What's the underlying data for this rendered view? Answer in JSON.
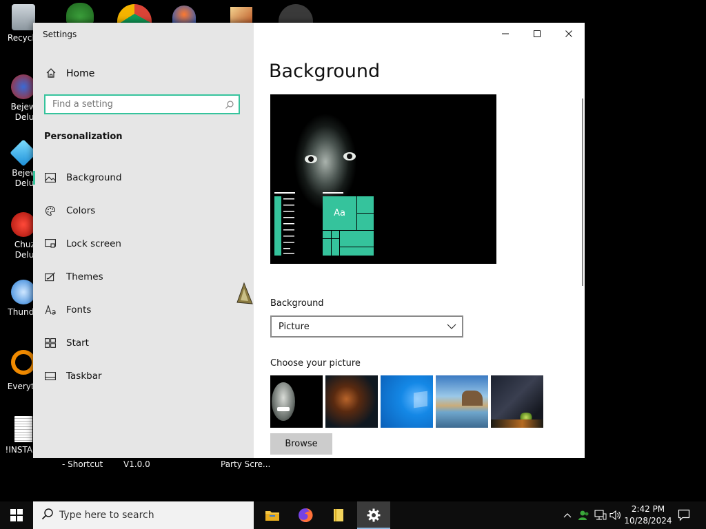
{
  "desktop": {
    "icons": [
      {
        "label": "Recycle"
      },
      {
        "label": "Bejewel Delux"
      },
      {
        "label": "Bejewe Delux"
      },
      {
        "label": "Chuzz Delux"
      },
      {
        "label": "Thunde"
      },
      {
        "label": "Everyth"
      },
      {
        "label": "!INSTALL"
      }
    ],
    "bottom_labels": [
      "- Shortcut",
      "V1.0.0",
      "Party Scre..."
    ]
  },
  "window": {
    "title": "Settings",
    "controls": {
      "minimize": "minimize",
      "maximize": "maximize",
      "close": "close"
    }
  },
  "sidebar": {
    "home_label": "Home",
    "search_placeholder": "Find a setting",
    "section_title": "Personalization",
    "items": [
      {
        "label": "Background",
        "icon": "picture-icon",
        "active": true
      },
      {
        "label": "Colors",
        "icon": "palette-icon",
        "active": false
      },
      {
        "label": "Lock screen",
        "icon": "lock-screen-icon",
        "active": false
      },
      {
        "label": "Themes",
        "icon": "themes-icon",
        "active": false
      },
      {
        "label": "Fonts",
        "icon": "fonts-icon",
        "active": false
      },
      {
        "label": "Start",
        "icon": "start-icon",
        "active": false
      },
      {
        "label": "Taskbar",
        "icon": "taskbar-icon",
        "active": false
      }
    ]
  },
  "main": {
    "title": "Background",
    "preview_tile_text": "Aa",
    "background_label": "Background",
    "background_value": "Picture",
    "choose_label": "Choose your picture",
    "browse_label": "Browse"
  },
  "taskbar": {
    "search_placeholder": "Type here to search",
    "time": "2:42 PM",
    "date": "10/28/2024"
  },
  "colors": {
    "accent": "#35c39c",
    "sidebar_bg": "#e6e6e6",
    "taskbar_bg": "#0d0d0d"
  }
}
